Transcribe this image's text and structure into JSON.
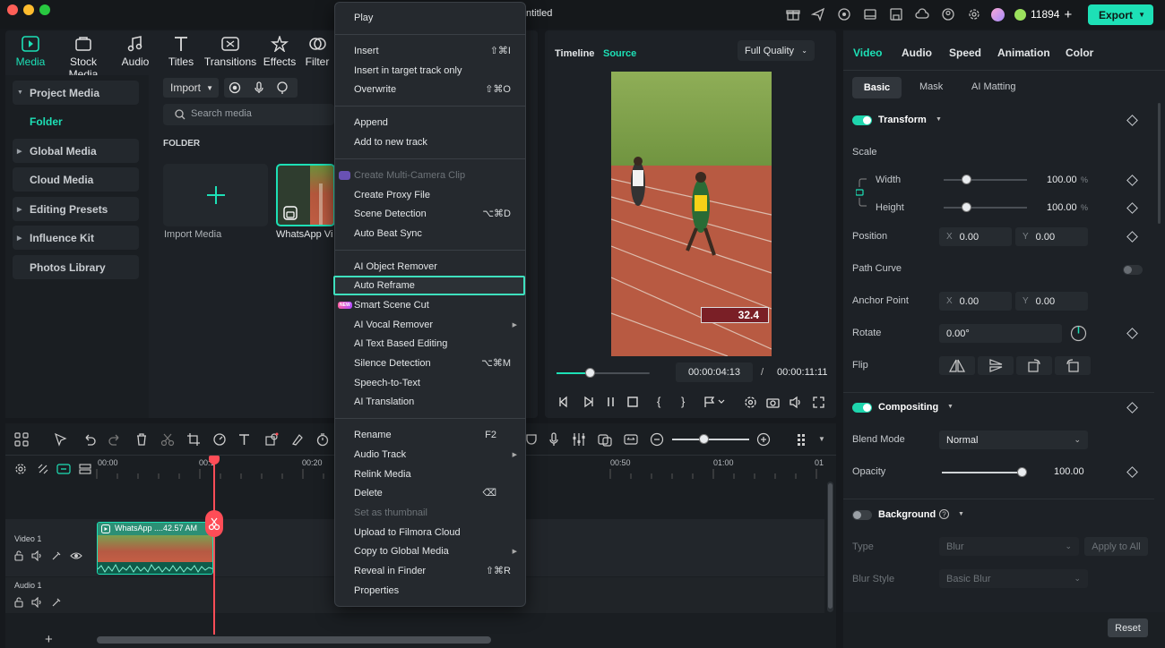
{
  "window": {
    "title": "ntitled",
    "credits": "11894",
    "export_label": "Export"
  },
  "top_tabs": [
    {
      "label": "Media",
      "icon": "media-icon",
      "active": true
    },
    {
      "label": "Stock Media",
      "icon": "stock-media-icon"
    },
    {
      "label": "Audio",
      "icon": "audio-icon"
    },
    {
      "label": "Titles",
      "icon": "titles-icon"
    },
    {
      "label": "Transitions",
      "icon": "transitions-icon"
    },
    {
      "label": "Effects",
      "icon": "effects-icon"
    },
    {
      "label": "Filter",
      "icon": "filters-icon"
    }
  ],
  "sidebar": {
    "project_media": "Project Media",
    "folder": "Folder",
    "global_media": "Global Media",
    "cloud_media": "Cloud Media",
    "editing_presets": "Editing Presets",
    "influence_kit": "Influence Kit",
    "photos_library": "Photos Library"
  },
  "media": {
    "import_label": "Import",
    "search_placeholder": "Search media",
    "folder_header": "FOLDER",
    "import_tile_label": "Import Media",
    "clip_label": "WhatsApp Vi"
  },
  "context_menu": {
    "items": [
      {
        "label": "Play"
      },
      {
        "label": "Insert",
        "shortcut": "⇧⌘I"
      },
      {
        "label": "Insert in target track only"
      },
      {
        "label": "Overwrite",
        "shortcut": "⇧⌘O"
      },
      {
        "label": "Append"
      },
      {
        "label": "Add to new track"
      },
      {
        "label": "Create Multi-Camera Clip",
        "disabled": true
      },
      {
        "label": "Create Proxy File"
      },
      {
        "label": "Scene Detection",
        "shortcut": "⌥⌘D"
      },
      {
        "label": "Auto Beat Sync"
      },
      {
        "label": "AI Object Remover"
      },
      {
        "label": "Auto Reframe",
        "highlighted": true
      },
      {
        "label": "Smart Scene Cut",
        "badge": "NEW"
      },
      {
        "label": "AI Vocal Remover",
        "submenu": true
      },
      {
        "label": "AI Text Based Editing"
      },
      {
        "label": "Silence Detection",
        "shortcut": "⌥⌘M"
      },
      {
        "label": "Speech-to-Text"
      },
      {
        "label": "AI Translation"
      },
      {
        "label": "Rename",
        "shortcut": "F2"
      },
      {
        "label": "Audio Track",
        "submenu": true
      },
      {
        "label": "Relink Media"
      },
      {
        "label": "Delete",
        "shortcut": "⌫"
      },
      {
        "label": "Set as thumbnail",
        "disabled": true
      },
      {
        "label": "Upload to Filmora Cloud"
      },
      {
        "label": "Copy to Global Media",
        "submenu": true
      },
      {
        "label": "Reveal in Finder",
        "shortcut": "⇧⌘R"
      },
      {
        "label": "Properties"
      }
    ]
  },
  "preview": {
    "tab_timeline": "Timeline",
    "tab_source": "Source",
    "quality": "Full Quality",
    "scoreboard": "32.4",
    "current_time": "00:00:04:13",
    "separator": "/",
    "total_time": "00:00:11:11",
    "progress": 0.37
  },
  "inspector": {
    "tabs": [
      "Video",
      "Audio",
      "Speed",
      "Animation",
      "Color"
    ],
    "subtabs": [
      "Basic",
      "Mask",
      "AI Matting"
    ],
    "transform": "Transform",
    "scale": "Scale",
    "width_label": "Width",
    "width_value": "100.00",
    "height_label": "Height",
    "height_value": "100.00",
    "unit": "%",
    "position": "Position",
    "pos_x": "0.00",
    "pos_y": "0.00",
    "x_prefix": "X",
    "y_prefix": "Y",
    "path_curve": "Path Curve",
    "anchor_point": "Anchor Point",
    "anchor_x": "0.00",
    "anchor_y": "0.00",
    "rotate": "Rotate",
    "rotate_value": "0.00°",
    "flip": "Flip",
    "compositing": "Compositing",
    "blend_mode": "Blend Mode",
    "blend_value": "Normal",
    "opacity": "Opacity",
    "opacity_value": "100.00",
    "background": "Background",
    "type": "Type",
    "type_value": "Blur",
    "apply_all": "Apply to All",
    "blur_style": "Blur Style",
    "blur_style_value": "Basic Blur",
    "reset": "Reset"
  },
  "timeline": {
    "ruler": [
      "00:00",
      "00:1",
      "00:20",
      "00:50",
      "01:00",
      "01"
    ],
    "video_track": "Video 1",
    "audio_track": "Audio 1",
    "clip_label": "WhatsApp ....42.57 AM"
  },
  "colors": {
    "accent": "#1de0b6",
    "playhead": "#ff4d57"
  }
}
